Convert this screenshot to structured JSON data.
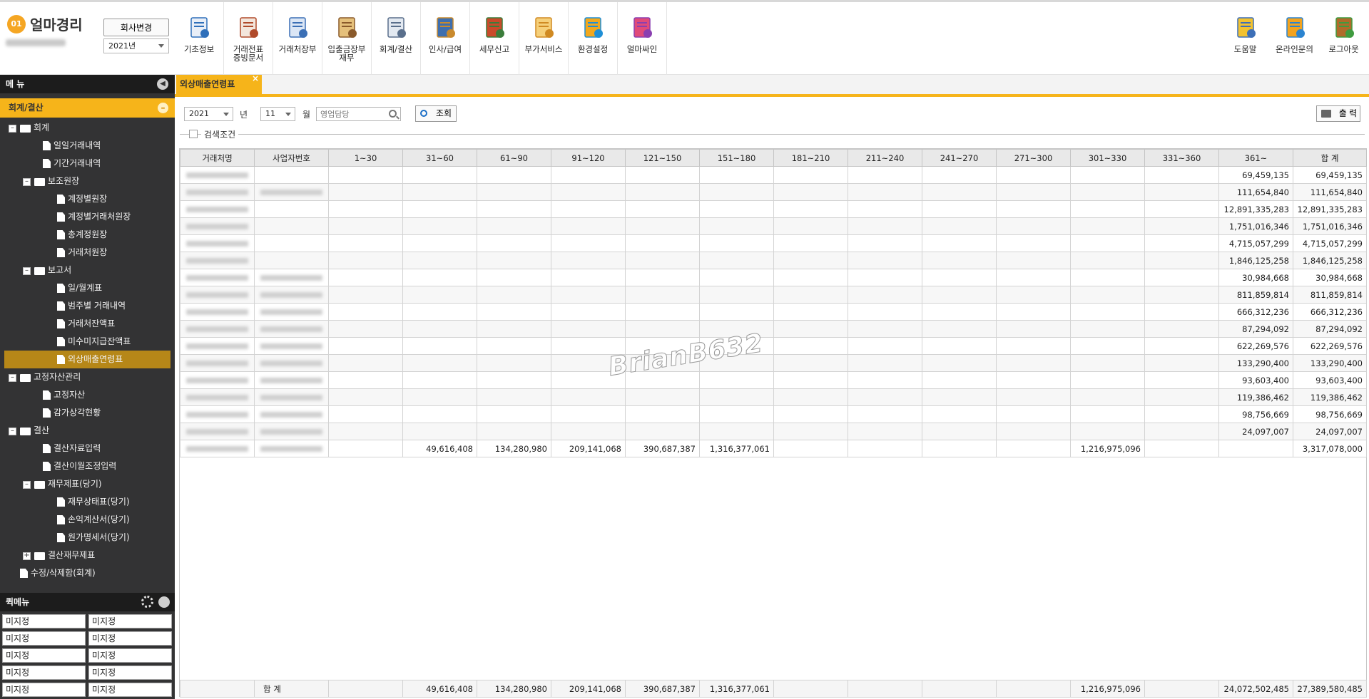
{
  "app": {
    "logo_badge": "01",
    "logo_text": "얼마경리",
    "company_change": "회사변경",
    "year": "2021년"
  },
  "nav_left": [
    {
      "label": "기초정보",
      "icon": "basic-info-icon"
    },
    {
      "label": "거래전표\n증빙문서",
      "icon": "voucher-icon"
    },
    {
      "label": "거래처장부",
      "icon": "ledger-icon"
    },
    {
      "label": "입출금장부\n재무",
      "icon": "money-bag-icon"
    },
    {
      "label": "회계/결산",
      "icon": "accounting-icon"
    },
    {
      "label": "인사/급여",
      "icon": "hr-icon"
    },
    {
      "label": "세무신고",
      "icon": "tax-icon"
    },
    {
      "label": "부가서비스",
      "icon": "bank-icon"
    },
    {
      "label": "환경설정",
      "icon": "gears-icon"
    },
    {
      "label": "얼마싸인",
      "icon": "sign-icon"
    }
  ],
  "nav_right": [
    {
      "label": "도움말",
      "icon": "help-book-icon"
    },
    {
      "label": "온라인문의",
      "icon": "online-support-icon"
    },
    {
      "label": "로그아웃",
      "icon": "logout-icon"
    }
  ],
  "sidebar": {
    "menu_title": "메 뉴",
    "section": "회계/결산",
    "tree": [
      {
        "label": "회계",
        "level": 0,
        "type": "folder",
        "pm": "-"
      },
      {
        "label": "일일거래내역",
        "level": 1,
        "type": "doc"
      },
      {
        "label": "기간거래내역",
        "level": 1,
        "type": "doc"
      },
      {
        "label": "보조원장",
        "level": 1,
        "type": "folder",
        "pm": "-"
      },
      {
        "label": "계정별원장",
        "level": 2,
        "type": "doc"
      },
      {
        "label": "계정별거래처원장",
        "level": 2,
        "type": "doc"
      },
      {
        "label": "총계정원장",
        "level": 2,
        "type": "doc"
      },
      {
        "label": "거래처원장",
        "level": 2,
        "type": "doc"
      },
      {
        "label": "보고서",
        "level": 1,
        "type": "folder",
        "pm": "-"
      },
      {
        "label": "일/월계표",
        "level": 2,
        "type": "doc"
      },
      {
        "label": "범주별 거래내역",
        "level": 2,
        "type": "doc"
      },
      {
        "label": "거래처잔액표",
        "level": 2,
        "type": "doc"
      },
      {
        "label": "미수미지급잔액표",
        "level": 2,
        "type": "doc"
      },
      {
        "label": "외상매출연령표",
        "level": 2,
        "type": "doc",
        "active": true
      },
      {
        "label": "고정자산관리",
        "level": 0,
        "type": "folder",
        "pm": "-"
      },
      {
        "label": "고정자산",
        "level": 1,
        "type": "doc"
      },
      {
        "label": "감가상각현황",
        "level": 1,
        "type": "doc"
      },
      {
        "label": "결산",
        "level": 0,
        "type": "folder",
        "pm": "-"
      },
      {
        "label": "결산자료입력",
        "level": 1,
        "type": "doc"
      },
      {
        "label": "결산이월조정입력",
        "level": 1,
        "type": "doc"
      },
      {
        "label": "재무제표(당기)",
        "level": 1,
        "type": "folder",
        "pm": "-"
      },
      {
        "label": "재무상태표(당기)",
        "level": 2,
        "type": "doc"
      },
      {
        "label": "손익계산서(당기)",
        "level": 2,
        "type": "doc"
      },
      {
        "label": "원가명세서(당기)",
        "level": 2,
        "type": "doc"
      },
      {
        "label": "결산재무제표",
        "level": 1,
        "type": "folder",
        "pm": "+"
      },
      {
        "label": "수정/삭제함(회계)",
        "level": 0,
        "type": "doc"
      }
    ],
    "quick_title": "퀵메뉴",
    "quick_items": [
      "미지정",
      "미지정",
      "미지정",
      "미지정",
      "미지정",
      "미지정",
      "미지정",
      "미지정",
      "미지정",
      "미지정"
    ]
  },
  "tab": {
    "label": "외상매출연령표",
    "close": "×"
  },
  "filters": {
    "year": "2021",
    "year_unit": "년",
    "month": "11",
    "month_unit": "월",
    "sales_placeholder": "영업담당",
    "query": "조회",
    "print": "출 력",
    "condition_label": "검색조건"
  },
  "table": {
    "headers": [
      "거래처명",
      "사업자번호",
      "1~30",
      "31~60",
      "61~90",
      "91~120",
      "121~150",
      "151~180",
      "181~210",
      "211~240",
      "241~270",
      "271~300",
      "301~330",
      "331~360",
      "361~",
      "합 계"
    ],
    "rows": [
      {
        "biz": false,
        "v": [
          "",
          "",
          "",
          "",
          "",
          "",
          "",
          "",
          "",
          "",
          "",
          "",
          "69,459,135",
          "69,459,135"
        ]
      },
      {
        "biz": true,
        "v": [
          "",
          "",
          "",
          "",
          "",
          "",
          "",
          "",
          "",
          "",
          "",
          "",
          "111,654,840",
          "111,654,840"
        ]
      },
      {
        "biz": false,
        "v": [
          "",
          "",
          "",
          "",
          "",
          "",
          "",
          "",
          "",
          "",
          "",
          "",
          "12,891,335,283",
          "12,891,335,283"
        ]
      },
      {
        "biz": false,
        "v": [
          "",
          "",
          "",
          "",
          "",
          "",
          "",
          "",
          "",
          "",
          "",
          "",
          "1,751,016,346",
          "1,751,016,346"
        ]
      },
      {
        "biz": false,
        "v": [
          "",
          "",
          "",
          "",
          "",
          "",
          "",
          "",
          "",
          "",
          "",
          "",
          "4,715,057,299",
          "4,715,057,299"
        ]
      },
      {
        "biz": false,
        "v": [
          "",
          "",
          "",
          "",
          "",
          "",
          "",
          "",
          "",
          "",
          "",
          "",
          "1,846,125,258",
          "1,846,125,258"
        ]
      },
      {
        "biz": true,
        "v": [
          "",
          "",
          "",
          "",
          "",
          "",
          "",
          "",
          "",
          "",
          "",
          "",
          "30,984,668",
          "30,984,668"
        ]
      },
      {
        "biz": true,
        "v": [
          "",
          "",
          "",
          "",
          "",
          "",
          "",
          "",
          "",
          "",
          "",
          "",
          "811,859,814",
          "811,859,814"
        ]
      },
      {
        "biz": true,
        "v": [
          "",
          "",
          "",
          "",
          "",
          "",
          "",
          "",
          "",
          "",
          "",
          "",
          "666,312,236",
          "666,312,236"
        ]
      },
      {
        "biz": true,
        "v": [
          "",
          "",
          "",
          "",
          "",
          "",
          "",
          "",
          "",
          "",
          "",
          "",
          "87,294,092",
          "87,294,092"
        ]
      },
      {
        "biz": true,
        "v": [
          "",
          "",
          "",
          "",
          "",
          "",
          "",
          "",
          "",
          "",
          "",
          "",
          "622,269,576",
          "622,269,576"
        ]
      },
      {
        "biz": true,
        "v": [
          "",
          "",
          "",
          "",
          "",
          "",
          "",
          "",
          "",
          "",
          "",
          "",
          "133,290,400",
          "133,290,400"
        ]
      },
      {
        "biz": true,
        "v": [
          "",
          "",
          "",
          "",
          "",
          "",
          "",
          "",
          "",
          "",
          "",
          "",
          "93,603,400",
          "93,603,400"
        ]
      },
      {
        "biz": true,
        "v": [
          "",
          "",
          "",
          "",
          "",
          "",
          "",
          "",
          "",
          "",
          "",
          "",
          "119,386,462",
          "119,386,462"
        ]
      },
      {
        "biz": true,
        "v": [
          "",
          "",
          "",
          "",
          "",
          "",
          "",
          "",
          "",
          "",
          "",
          "",
          "98,756,669",
          "98,756,669"
        ]
      },
      {
        "biz": true,
        "v": [
          "",
          "",
          "",
          "",
          "",
          "",
          "",
          "",
          "",
          "",
          "",
          "",
          "24,097,007",
          "24,097,007"
        ]
      },
      {
        "biz": true,
        "v": [
          "",
          "49,616,408",
          "134,280,980",
          "209,141,068",
          "390,687,387",
          "1,316,377,061",
          "",
          "",
          "",
          "",
          "1,216,975,096",
          "",
          "",
          "3,317,078,000"
        ]
      }
    ],
    "total_label": "합 계",
    "totals": [
      "",
      "49,616,408",
      "134,280,980",
      "209,141,068",
      "390,687,387",
      "1,316,377,061",
      "",
      "",
      "",
      "",
      "1,216,975,096",
      "",
      "24,072,502,485",
      "27,389,580,485"
    ]
  },
  "watermark": "BrianB632",
  "colors": {
    "accent": "#f6b41a",
    "sidebar_bg": "#333334",
    "active_item": "#b68718"
  }
}
